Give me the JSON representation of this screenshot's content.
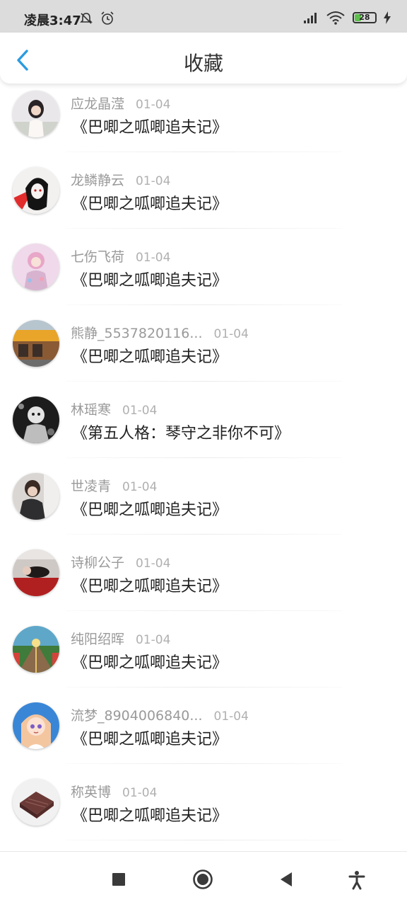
{
  "status_bar": {
    "time": "凌晨3:47",
    "battery": "28"
  },
  "header": {
    "title": "收藏"
  },
  "favorites": [
    {
      "user": "应龙晶滢",
      "date": "01-04",
      "work": "《巴唧之呱唧追夫记》"
    },
    {
      "user": "龙鳞静云",
      "date": "01-04",
      "work": "《巴唧之呱唧追夫记》"
    },
    {
      "user": "七伤飞荷",
      "date": "01-04",
      "work": "《巴唧之呱唧追夫记》"
    },
    {
      "user": "熊静_5537820116...",
      "date": "01-04",
      "work": "《巴唧之呱唧追夫记》"
    },
    {
      "user": "林瑶寒",
      "date": "01-04",
      "work": "《第五人格：琴守之非你不可》"
    },
    {
      "user": "世凌青",
      "date": "01-04",
      "work": "《巴唧之呱唧追夫记》"
    },
    {
      "user": "诗柳公子",
      "date": "01-04",
      "work": "《巴唧之呱唧追夫记》"
    },
    {
      "user": "纯阳绍晖",
      "date": "01-04",
      "work": "《巴唧之呱唧追夫记》"
    },
    {
      "user": "流梦_8904006840...",
      "date": "01-04",
      "work": "《巴唧之呱唧追夫记》"
    },
    {
      "user": "称英博",
      "date": "01-04",
      "work": "《巴唧之呱唧追夫记》"
    }
  ],
  "colors": {
    "accent": "#2b9be0",
    "status_bar_bg": "#dcdcdc"
  }
}
